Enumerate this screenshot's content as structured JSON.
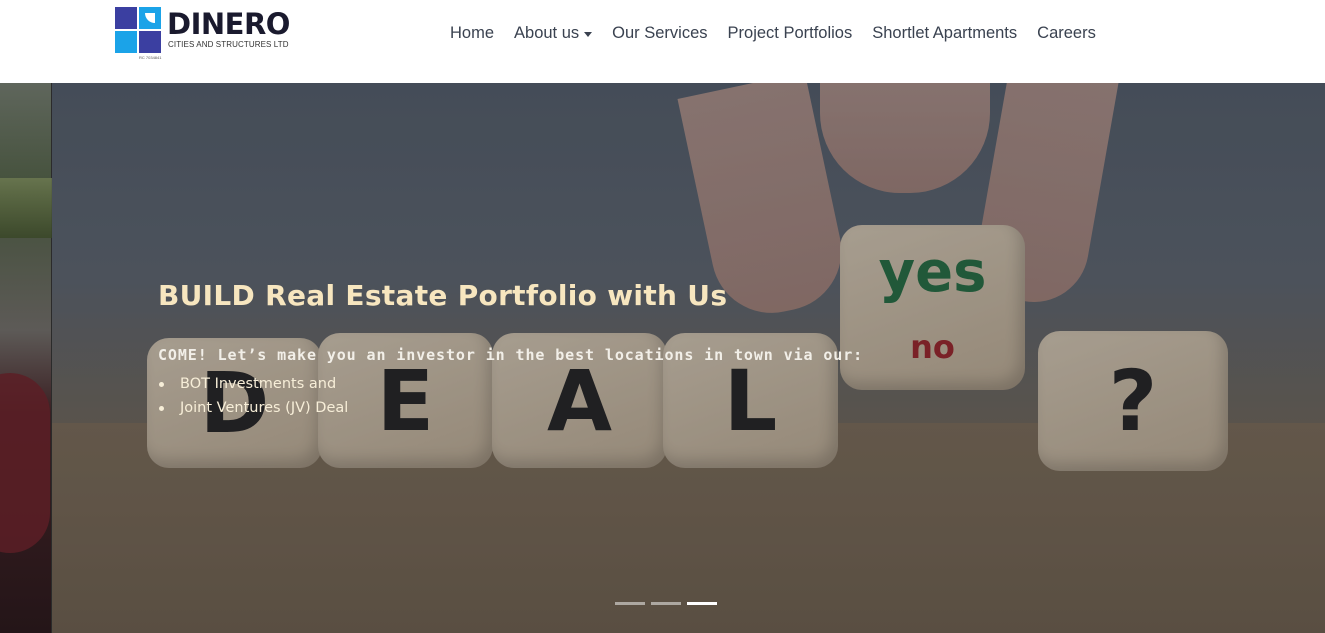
{
  "brand": {
    "name": "DINERO",
    "subtitle": "CITIES AND STRUCTURES LTD",
    "rc": "RC 7034841",
    "colors": {
      "dark_blue": "#3b3fa1",
      "light_blue": "#1ba3e8"
    }
  },
  "nav": {
    "items": [
      {
        "label": "Home",
        "dropdown": false
      },
      {
        "label": "About us",
        "dropdown": true
      },
      {
        "label": "Our Services",
        "dropdown": false
      },
      {
        "label": "Project Portfolios",
        "dropdown": false
      },
      {
        "label": "Shortlet Apartments",
        "dropdown": false
      },
      {
        "label": "Careers",
        "dropdown": false
      }
    ]
  },
  "hero": {
    "headline": "BUILD Real Estate Portfolio with Us",
    "subline": "COME! Let’s make you an investor in the best locations in town via our:",
    "bullets": [
      "BOT Investments and",
      "Joint Ventures (JV) Deal"
    ],
    "dice_letters": [
      "D",
      "E",
      "A",
      "L",
      "?"
    ],
    "dice_yes": "yes",
    "dice_no": "no",
    "slide_count": 3,
    "active_slide": 3,
    "colors": {
      "headline": "#f7e6bf",
      "text": "#f2efe8"
    }
  }
}
